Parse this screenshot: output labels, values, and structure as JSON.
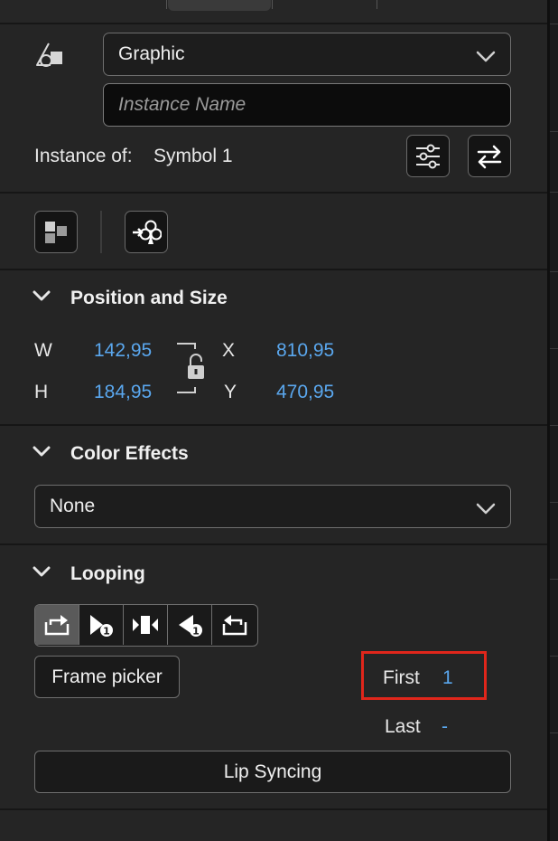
{
  "instance": {
    "type_selected": "Graphic",
    "name_placeholder": "Instance Name",
    "instance_of_label": "Instance of:",
    "symbol_name": "Symbol 1"
  },
  "position_size": {
    "title": "Position and Size",
    "w_label": "W",
    "w_value": "142,95",
    "h_label": "H",
    "h_value": "184,95",
    "x_label": "X",
    "x_value": "810,95",
    "y_label": "Y",
    "y_value": "470,95"
  },
  "color_effects": {
    "title": "Color Effects",
    "selected": "None"
  },
  "looping": {
    "title": "Looping",
    "active_mode": "loop",
    "modes": [
      "loop",
      "play-once",
      "single-frame",
      "play-once-reverse",
      "loop-reverse"
    ],
    "frame_picker_label": "Frame picker",
    "first_label": "First",
    "first_value": "1",
    "last_label": "Last",
    "last_value": "-",
    "lip_syncing_label": "Lip Syncing"
  },
  "colors": {
    "panel_bg": "#252525",
    "value_blue": "#5aa7ee",
    "highlight_red": "#e0261b"
  }
}
